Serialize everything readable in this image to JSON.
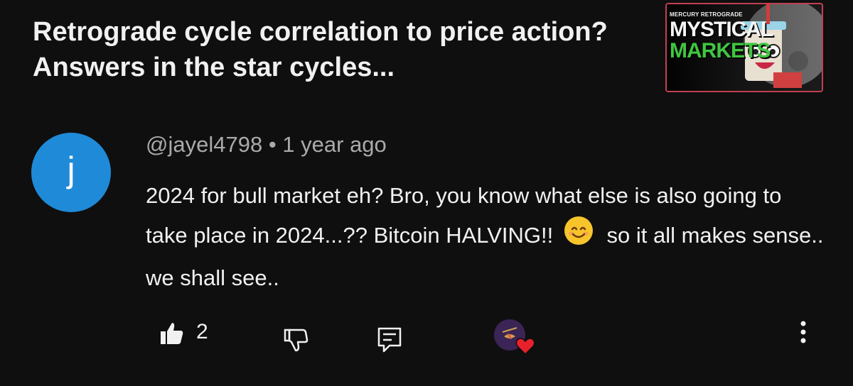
{
  "video": {
    "title": "Retrograde cycle correlation to price action? Answers in the star cycles...",
    "thumbnail": {
      "small_text": "MERCURY RETROGRADE",
      "line1": "MYSTICAL",
      "line2": "MARKETS"
    }
  },
  "comment": {
    "avatar_letter": "j",
    "avatar_color": "#1f8ad8",
    "author": "@jayel4798",
    "time": "1 year ago",
    "text_part1": "2024 for bull market eh? Bro, you know what else is also going to take place in 2024...?? Bitcoin HALVING!!",
    "emoji": "smiling-face-icon",
    "text_part2": "so it all makes sense.. we shall see..",
    "like_count": "2"
  },
  "icons": {
    "like": "thumbs-up-icon",
    "dislike": "thumbs-down-icon",
    "reply": "reply-icon",
    "creator_heart": "heart-icon",
    "more": "more-vertical-icon"
  },
  "colors": {
    "background": "#0f0f0f",
    "heart": "#e6212b",
    "thumbnail_border": "#c04050",
    "markets_green": "#3fc640"
  }
}
